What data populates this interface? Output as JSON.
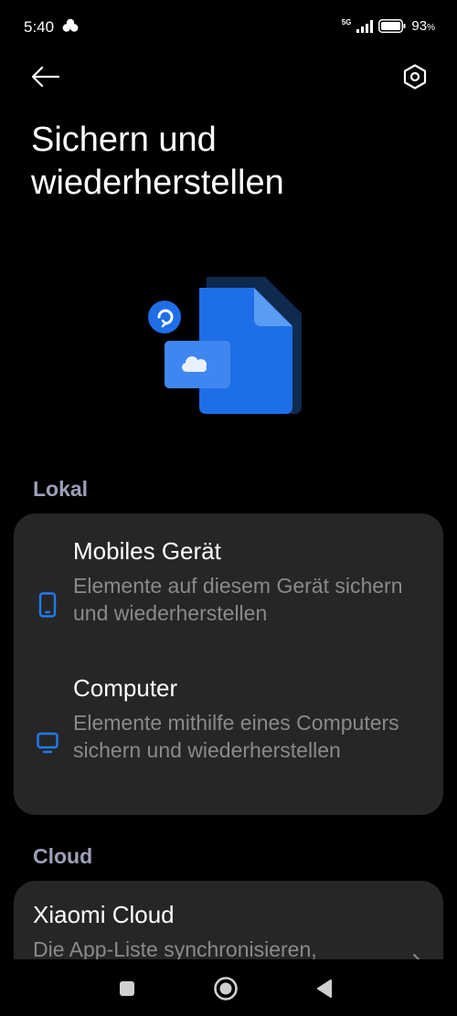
{
  "status_bar": {
    "time": "5:40",
    "network": "5G",
    "battery": "93",
    "battery_unit": "%"
  },
  "toolbar": {
    "back_icon": "arrow-left-icon",
    "settings_icon": "hexagon-gear-icon"
  },
  "page": {
    "title": "Sichern und wiederherstellen"
  },
  "sections": {
    "local": {
      "label": "Lokal",
      "items": [
        {
          "title": "Mobiles Gerät",
          "description": "Elemente auf diesem Gerät sichern und wiederherstellen",
          "icon": "phone-icon"
        },
        {
          "title": "Computer",
          "description": "Elemente mithilfe eines Computers sichern und wiederherstellen",
          "icon": "monitor-icon"
        }
      ]
    },
    "cloud": {
      "label": "Cloud",
      "items": [
        {
          "title": "Xiaomi Cloud",
          "description": "Die App-Liste synchronisieren,"
        }
      ]
    }
  },
  "colors": {
    "accent": "#1e7cf2",
    "card_bg": "#262626",
    "section_label": "#9ea0b7",
    "secondary_text": "#8a8a8a"
  },
  "nav_bar": {
    "recents_icon": "square-icon",
    "home_icon": "circle-icon",
    "back_icon": "triangle-back-icon"
  }
}
